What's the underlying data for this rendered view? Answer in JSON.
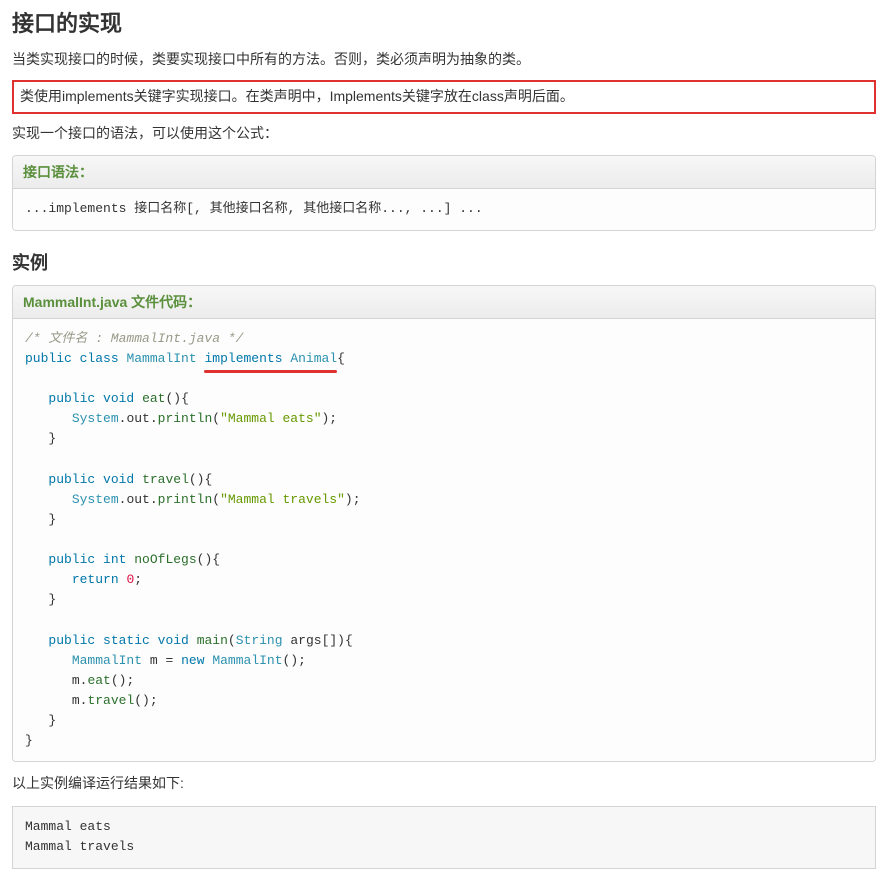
{
  "heading": "接口的实现",
  "para1": "当类实现接口的时候，类要实现接口中所有的方法。否则，类必须声明为抽象的类。",
  "para2_boxed": "类使用implements关键字实现接口。在类声明中，Implements关键字放在class声明后面。",
  "para3": "实现一个接口的语法，可以使用这个公式：",
  "syntax_block": {
    "title": "接口语法：",
    "line": "...implements 接口名称[, 其他接口名称, 其他接口名称..., ...] ..."
  },
  "example_heading": "实例",
  "example_block": {
    "title": "MammalInt.java 文件代码：",
    "tokens": {
      "comment": "/* 文件名 : MammalInt.java */",
      "public": "public",
      "class": "class",
      "MammalInt": "MammalInt",
      "implements": "implements",
      "Animal": "Animal",
      "void": "void",
      "eat": "eat",
      "System": "System",
      "out": "out",
      "println": "println",
      "str_eats": "\"Mammal eats\"",
      "travel": "travel",
      "str_travels": "\"Mammal travels\"",
      "int": "int",
      "noOfLegs": "noOfLegs",
      "return": "return",
      "zero": "0",
      "static": "static",
      "main": "main",
      "String": "String",
      "args": "args",
      "m": "m",
      "new": "new"
    }
  },
  "result_label": "以上实例编译运行结果如下:",
  "output": {
    "line1": "Mammal eats",
    "line2": "Mammal travels"
  }
}
